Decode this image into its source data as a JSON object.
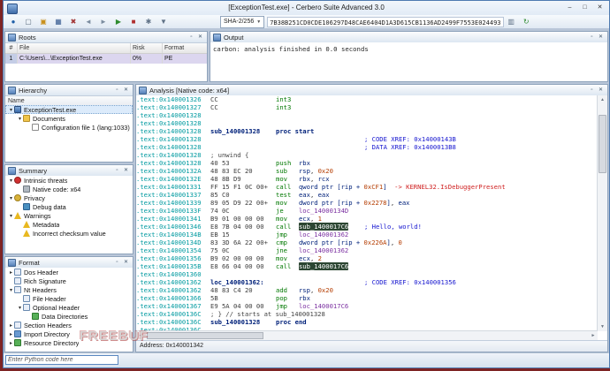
{
  "window": {
    "title": "[ExceptionTest.exe] - Cerbero Suite Advanced 3.0",
    "controls": {
      "minimize": "–",
      "maximize": "□",
      "close": "✕"
    }
  },
  "toolbar": {
    "hash_algo": "SHA-2/256",
    "hash_value": "7B38B251CD0CDE106297D48CAE6404D1A3D615CB1136AD2499F7553E024493",
    "left_icons": [
      {
        "name": "app-logo",
        "glyph": "●",
        "color": "#1f5fa8"
      },
      {
        "name": "new-file",
        "glyph": "▢",
        "color": "#5a6b7d"
      },
      {
        "name": "open-file",
        "glyph": "▣",
        "color": "#c8901c"
      },
      {
        "name": "save-file",
        "glyph": "▦",
        "color": "#35598f"
      },
      {
        "name": "close-file",
        "glyph": "✖",
        "color": "#a23535"
      },
      {
        "name": "back",
        "glyph": "◄",
        "color": "#7c8da0"
      },
      {
        "name": "forward",
        "glyph": "►",
        "color": "#7c8da0"
      },
      {
        "name": "run-analysis",
        "glyph": "▶",
        "color": "#2e8b2e"
      },
      {
        "name": "stop-analysis",
        "glyph": "■",
        "color": "#b03030"
      },
      {
        "name": "tools",
        "glyph": "✱",
        "color": "#5f7186"
      },
      {
        "name": "filters",
        "glyph": "▼",
        "color": "#5f7186"
      }
    ],
    "right_icons": [
      {
        "name": "copy-hash",
        "glyph": "▥",
        "color": "#5f7186"
      },
      {
        "name": "recompute-hash",
        "glyph": "↻",
        "color": "#2e8b2e"
      }
    ]
  },
  "panel_buttons": [
    {
      "name": "float-panel",
      "glyph": "▫"
    },
    {
      "name": "close-panel",
      "glyph": "✕"
    }
  ],
  "roots": {
    "title": "Roots",
    "columns": [
      "#",
      "File",
      "Risk",
      "Format"
    ],
    "rows": [
      [
        "1",
        "C:\\Users\\...\\ExceptionTest.exe",
        "0%",
        "PE"
      ]
    ]
  },
  "output": {
    "title": "Output",
    "lines": [
      "carbon: analysis finished in 0.0 seconds"
    ]
  },
  "hierarchy": {
    "title": "Hierarchy",
    "column": "Name",
    "items": [
      {
        "label": "ExceptionTest.exe",
        "level": 0,
        "icon": "exe",
        "exp": "open",
        "selected": true
      },
      {
        "label": "Documents",
        "level": 1,
        "icon": "folder",
        "exp": "open"
      },
      {
        "label": "Configuration file 1 (lang:1033)",
        "level": 2,
        "icon": "config"
      }
    ]
  },
  "summary": {
    "title": "Summary",
    "items": [
      {
        "label": "Intrinsic threats",
        "level": 0,
        "icon": "threat",
        "exp": "open"
      },
      {
        "label": "Native code: x64",
        "level": 1,
        "icon": "chip"
      },
      {
        "label": "Privacy",
        "level": 0,
        "icon": "key",
        "exp": "open"
      },
      {
        "label": "Debug data",
        "level": 1,
        "icon": "debug"
      },
      {
        "label": "Warnings",
        "level": 0,
        "icon": "warn",
        "exp": "open"
      },
      {
        "label": "Metadata",
        "level": 1,
        "icon": "warn"
      },
      {
        "label": "Incorrect checksum value",
        "level": 1,
        "icon": "warn"
      }
    ]
  },
  "format": {
    "title": "Format",
    "items": [
      {
        "label": "Dos Header",
        "level": 0,
        "icon": "page",
        "exp": "closed"
      },
      {
        "label": "Rich Signature",
        "level": 0,
        "icon": "page"
      },
      {
        "label": "Nt Headers",
        "level": 0,
        "icon": "page",
        "exp": "open"
      },
      {
        "label": "File Header",
        "level": 1,
        "icon": "page"
      },
      {
        "label": "Optional Header",
        "level": 1,
        "icon": "page",
        "exp": "open"
      },
      {
        "label": "Data Directories",
        "level": 2,
        "icon": "page-green"
      },
      {
        "label": "Section Headers",
        "level": 0,
        "icon": "page",
        "exp": "closed"
      },
      {
        "label": "Import Directory",
        "level": 0,
        "icon": "import",
        "exp": "closed"
      },
      {
        "label": "Resource Directory",
        "level": 0,
        "icon": "resource",
        "exp": "closed"
      }
    ]
  },
  "analysis": {
    "title": "Analysis [Native code: x64]",
    "address_label": "Address: 0x140001342",
    "lines": [
      {
        "a": ".text:0x140001326",
        "b": "CC",
        "s": [
          [
            "int3",
            "mn"
          ]
        ]
      },
      {
        "a": ".text:0x140001327",
        "b": "CC",
        "s": [
          [
            "int3",
            "mn"
          ]
        ]
      },
      {
        "a": ".text:0x140001328"
      },
      {
        "a": ".text:0x140001328"
      },
      {
        "a": ".text:0x140001328",
        "b": "sub_140001328",
        "bc": "sym",
        "s": [
          [
            "proc start",
            "kw"
          ]
        ]
      },
      {
        "a": ".text:0x140001328",
        "f": "; CODE XREF: 0x14000143B"
      },
      {
        "a": ".text:0x140001328",
        "f": "; DATA XREF: 0x1400013B8"
      },
      {
        "a": ".text:0x140001328",
        "raw": 1,
        "s": [
          [
            "; unwind {",
            "unw"
          ]
        ]
      },
      {
        "a": ".text:0x140001328",
        "b": "40 53",
        "s": [
          [
            "push  ",
            "mn"
          ],
          [
            "rbx",
            "op"
          ]
        ]
      },
      {
        "a": ".text:0x14000132A",
        "b": "48 83 EC 20",
        "s": [
          [
            "sub   ",
            "mn"
          ],
          [
            "rsp",
            "op"
          ],
          [
            ", ",
            "pl"
          ],
          [
            "0x20",
            "num"
          ]
        ]
      },
      {
        "a": ".text:0x14000132E",
        "b": "48 8B D9",
        "s": [
          [
            "mov   ",
            "mn"
          ],
          [
            "rbx",
            "op"
          ],
          [
            ", ",
            "pl"
          ],
          [
            "rcx",
            "op"
          ]
        ]
      },
      {
        "a": ".text:0x140001331",
        "b": "FF 15 F1 0C 00+",
        "s": [
          [
            "call  ",
            "mn"
          ],
          [
            "qword ptr [rip + ",
            "op"
          ],
          [
            "0xCF1",
            "num"
          ],
          [
            "]",
            "op"
          ],
          [
            "  -> KERNEL32.IsDebuggerPresent",
            "api"
          ]
        ]
      },
      {
        "a": ".text:0x140001337",
        "b": "85 C0",
        "s": [
          [
            "test  ",
            "mn"
          ],
          [
            "eax",
            "op"
          ],
          [
            ", ",
            "pl"
          ],
          [
            "eax",
            "op"
          ]
        ]
      },
      {
        "a": ".text:0x140001339",
        "b": "89 05 D9 22 00+",
        "s": [
          [
            "mov   ",
            "mn"
          ],
          [
            "dword ptr [rip + ",
            "op"
          ],
          [
            "0x2278",
            "num"
          ],
          [
            "]",
            "op"
          ],
          [
            ", ",
            "pl"
          ],
          [
            "eax",
            "op"
          ]
        ]
      },
      {
        "a": ".text:0x14000133F",
        "b": "74 0C",
        "s": [
          [
            "je    ",
            "mn"
          ],
          [
            "loc_14000134D",
            "loc"
          ]
        ]
      },
      {
        "a": ".text:0x140001341",
        "b": "B9 01 00 00 00",
        "s": [
          [
            "mov   ",
            "mn"
          ],
          [
            "ecx",
            "op"
          ],
          [
            ", ",
            "pl"
          ],
          [
            "1",
            "num"
          ]
        ]
      },
      {
        "a": ".text:0x140001346",
        "b": "E8 7B 04 00 00",
        "s": [
          [
            "call  ",
            "mn"
          ],
          [
            "sub_1400017C6",
            "hl"
          ]
        ],
        "f": "; Hello, world!"
      },
      {
        "a": ".text:0x14000134B",
        "b": "EB 15",
        "s": [
          [
            "jmp   ",
            "mn"
          ],
          [
            "loc_140001362",
            "loc"
          ]
        ]
      },
      {
        "a": ".text:0x14000134D",
        "b": "83 3D 6A 22 00+",
        "s": [
          [
            "cmp   ",
            "mn"
          ],
          [
            "dword ptr [rip + ",
            "op"
          ],
          [
            "0x226A",
            "num"
          ],
          [
            "]",
            "op"
          ],
          [
            ", ",
            "pl"
          ],
          [
            "0",
            "num"
          ]
        ]
      },
      {
        "a": ".text:0x140001354",
        "b": "75 0C",
        "s": [
          [
            "jne   ",
            "mn"
          ],
          [
            "loc_140001362",
            "loc"
          ]
        ]
      },
      {
        "a": ".text:0x140001356",
        "b": "B9 02 00 00 00",
        "s": [
          [
            "mov   ",
            "mn"
          ],
          [
            "ecx",
            "op"
          ],
          [
            ", ",
            "pl"
          ],
          [
            "2",
            "num"
          ]
        ]
      },
      {
        "a": ".text:0x14000135B",
        "b": "E8 66 04 00 00",
        "s": [
          [
            "call  ",
            "mn"
          ],
          [
            "sub_1400017C6",
            "hl"
          ]
        ]
      },
      {
        "a": ".text:0x140001360"
      },
      {
        "a": ".text:0x140001362",
        "raw": 1,
        "s": [
          [
            "loc_140001362:",
            "lbl"
          ]
        ],
        "f": "; CODE XREF: 0x140001356"
      },
      {
        "a": ".text:0x140001362",
        "b": "48 83 C4 20",
        "s": [
          [
            "add   ",
            "mn"
          ],
          [
            "rsp",
            "op"
          ],
          [
            ", ",
            "pl"
          ],
          [
            "0x20",
            "num"
          ]
        ]
      },
      {
        "a": ".text:0x140001366",
        "b": "5B",
        "s": [
          [
            "pop   ",
            "mn"
          ],
          [
            "rbx",
            "op"
          ]
        ]
      },
      {
        "a": ".text:0x140001367",
        "b": "E9 5A 04 00 00",
        "s": [
          [
            "jmp   ",
            "mn"
          ],
          [
            "loc_1400017C6",
            "loc"
          ]
        ]
      },
      {
        "a": ".text:0x14000136C",
        "raw": 1,
        "s": [
          [
            "; } // starts at sub_140001328",
            "unw"
          ]
        ]
      },
      {
        "a": ".text:0x14000136C",
        "b": "sub_140001328",
        "bc": "sym",
        "s": [
          [
            "proc end",
            "kw"
          ]
        ]
      },
      {
        "a": ".text:0x14000136C"
      }
    ]
  },
  "console": {
    "placeholder": "Enter Python code here"
  },
  "watermark": "FREEBUF"
}
